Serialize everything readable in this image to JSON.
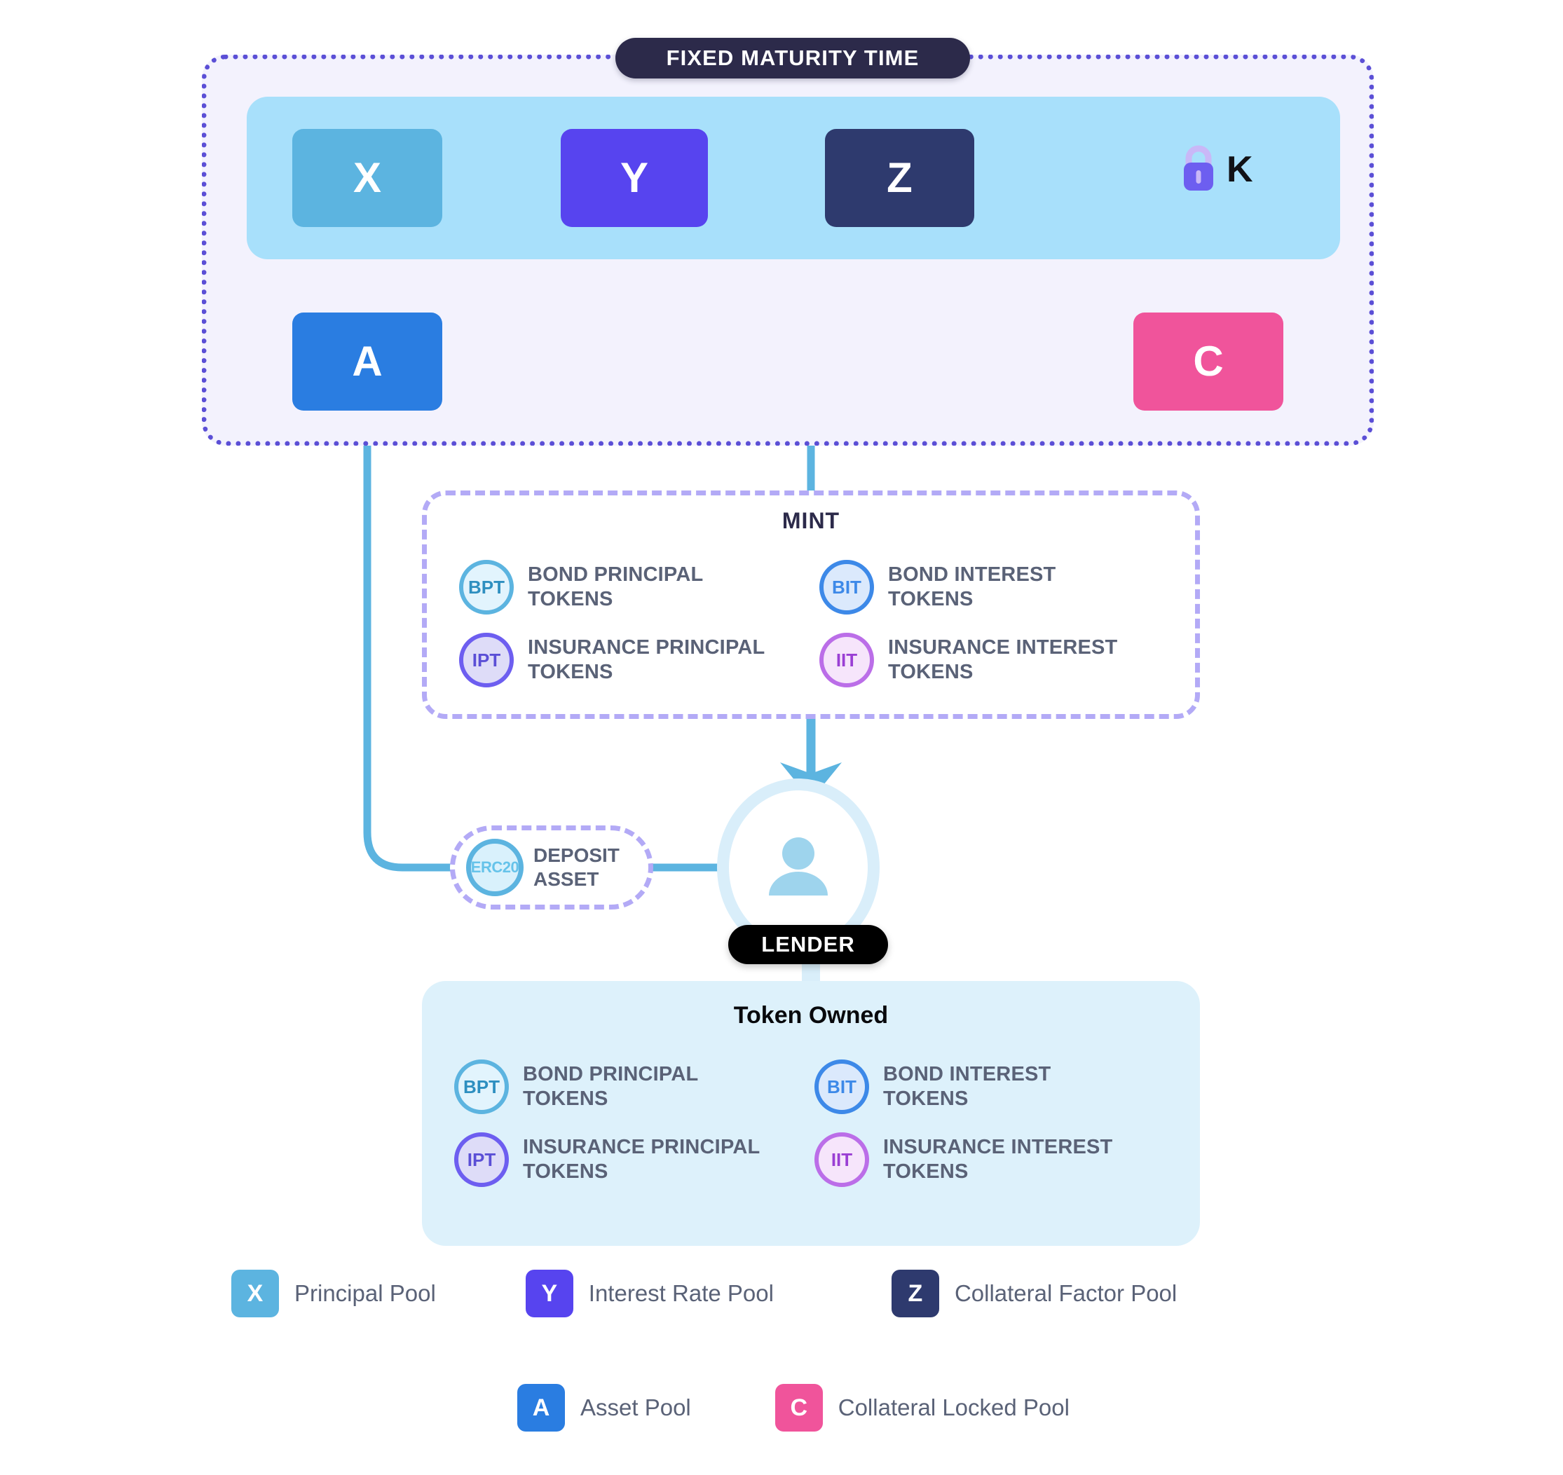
{
  "fixed_maturity": {
    "badge": "FIXED MATURITY TIME",
    "pools": [
      {
        "letter": "X",
        "name": "principal-pool",
        "color": "#5cb4e0"
      },
      {
        "letter": "Y",
        "name": "interest-rate-pool",
        "color": "#5744ef"
      },
      {
        "letter": "Z",
        "name": "collateral-factor-pool",
        "color": "#2e3a6e"
      },
      {
        "letter": "A",
        "name": "asset-pool",
        "color": "#2a7de1"
      },
      {
        "letter": "C",
        "name": "collateral-locked-pool",
        "color": "#f0549b"
      }
    ],
    "lock_label": "K"
  },
  "mint": {
    "title": "MINT",
    "tokens": [
      {
        "abbr": "BPT",
        "label": "BOND PRINCIPAL\nTOKENS",
        "line1": "BOND PRINCIPAL",
        "line2": "TOKENS"
      },
      {
        "abbr": "BIT",
        "label": "BOND INTEREST\nTOKENS",
        "line1": "BOND INTEREST",
        "line2": "TOKENS"
      },
      {
        "abbr": "IPT",
        "label": "INSURANCE PRINCIPAL\nTOKENS",
        "line1": "INSURANCE PRINCIPAL",
        "line2": "TOKENS"
      },
      {
        "abbr": "IIT",
        "label": "INSURANCE INTEREST\nTOKENS",
        "line1": "INSURANCE INTEREST",
        "line2": "TOKENS"
      }
    ]
  },
  "deposit": {
    "badge": "ERC20",
    "line1": "DEPOSIT",
    "line2": "ASSET"
  },
  "lender": {
    "badge": "LENDER"
  },
  "token_owned": {
    "title": "Token Owned",
    "tokens": [
      {
        "abbr": "BPT",
        "line1": "BOND PRINCIPAL",
        "line2": "TOKENS"
      },
      {
        "abbr": "BIT",
        "line1": "BOND INTEREST",
        "line2": "TOKENS"
      },
      {
        "abbr": "IPT",
        "line1": "INSURANCE PRINCIPAL",
        "line2": "TOKENS"
      },
      {
        "abbr": "IIT",
        "line1": "INSURANCE INTEREST",
        "line2": "TOKENS"
      }
    ]
  },
  "legend": {
    "row1": [
      {
        "letter": "X",
        "text": "Principal Pool",
        "color": "#5cb4e0"
      },
      {
        "letter": "Y",
        "text": "Interest Rate Pool",
        "color": "#5744ef"
      },
      {
        "letter": "Z",
        "text": "Collateral Factor Pool",
        "color": "#2e3a6e"
      }
    ],
    "row2": [
      {
        "letter": "A",
        "text": "Asset Pool",
        "color": "#2a7de1"
      },
      {
        "letter": "C",
        "text": "Collateral Locked Pool",
        "color": "#f0549b"
      }
    ]
  },
  "colors": {
    "dotted_border": "#5b4fd6",
    "dashed_border": "#b3aaf6",
    "band": "#a8e0fb",
    "wire": "#5cb4e0",
    "panel_bg": "#f3f2fd",
    "owned_bg": "#ddf1fb",
    "badge_dark": "#2c2a4a",
    "badge_black": "#000000",
    "label_text": "#5a6277"
  }
}
